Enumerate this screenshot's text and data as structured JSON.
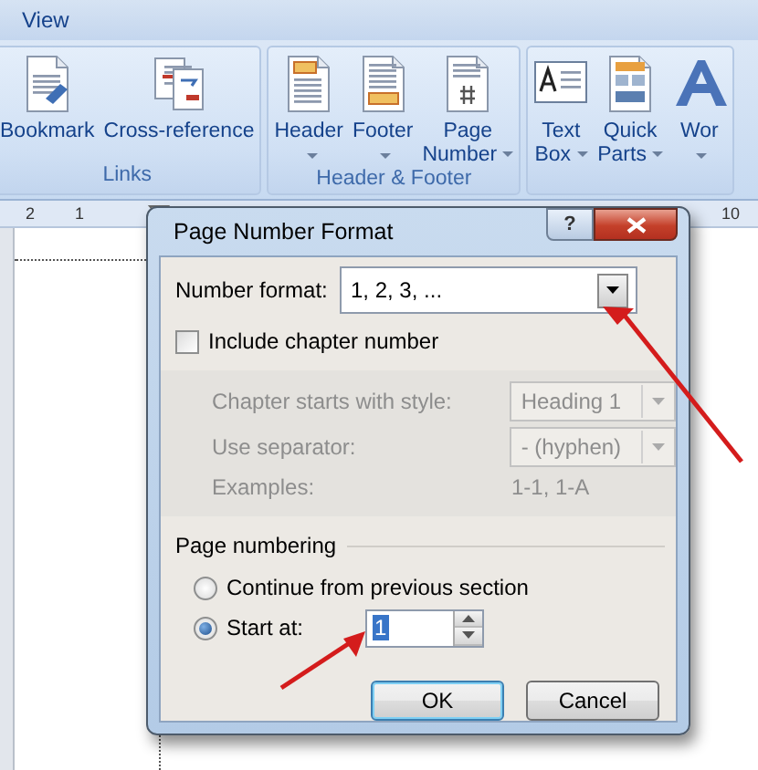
{
  "menu": {
    "items": [
      {
        "label": "View"
      }
    ]
  },
  "ribbon": {
    "groups": [
      {
        "label": "Links",
        "buttons": [
          {
            "lines": [
              "Bookmark"
            ],
            "dropdown": false
          },
          {
            "lines": [
              "Cross-reference"
            ],
            "dropdown": false
          }
        ]
      },
      {
        "label": "Header & Footer",
        "buttons": [
          {
            "lines": [
              "Header"
            ],
            "dropdown": true
          },
          {
            "lines": [
              "Footer"
            ],
            "dropdown": true
          },
          {
            "lines": [
              "Page",
              "Number"
            ],
            "dropdown": true
          }
        ]
      },
      {
        "buttons": [
          {
            "lines": [
              "Text",
              "Box"
            ],
            "dropdown": true
          },
          {
            "lines": [
              "Quick",
              "Parts"
            ],
            "dropdown": true
          },
          {
            "lines": [
              "Wor"
            ],
            "dropdown": true
          }
        ]
      }
    ]
  },
  "ruler": {
    "left_labels": [
      "2",
      "1"
    ],
    "right_labels": [
      "10"
    ]
  },
  "dialog": {
    "title": "Page Number Format",
    "help": "?",
    "number_format": {
      "label": "Number format:",
      "value": "1, 2, 3, ..."
    },
    "include_chapter": {
      "label": "Include chapter number",
      "checked": false
    },
    "chapter_fields": [
      {
        "label": "Chapter starts with style:",
        "value": "Heading 1",
        "disabled": true,
        "kind": "combo"
      },
      {
        "label": "Use separator:",
        "value": "-   (hyphen)",
        "disabled": true,
        "kind": "combo"
      },
      {
        "label": "Examples:",
        "value": "1-1, 1-A",
        "disabled": true,
        "kind": "text"
      }
    ],
    "page_numbering": {
      "label": "Page numbering",
      "options": [
        {
          "label": "Continue from previous section",
          "selected": false
        },
        {
          "label": "Start at:",
          "selected": true
        }
      ],
      "start_at": "1"
    },
    "buttons": [
      {
        "label": "OK",
        "default": true
      },
      {
        "label": "Cancel",
        "default": false
      }
    ]
  }
}
